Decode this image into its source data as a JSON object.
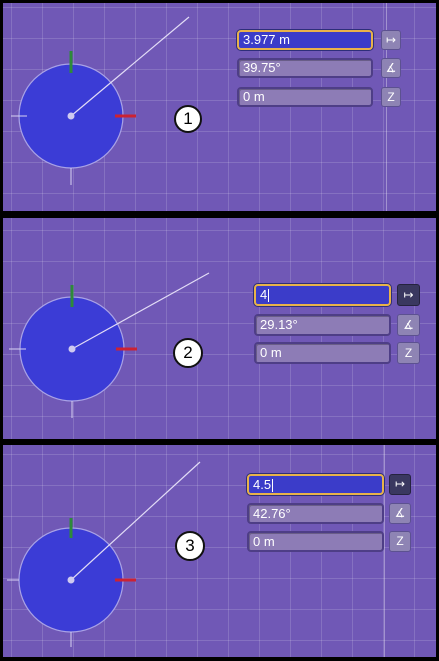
{
  "steps": [
    {
      "number": "1",
      "distance": "3.977 m",
      "angle": "39.75°",
      "z": "0 m"
    },
    {
      "number": "2",
      "distance": "4",
      "angle": "29.13°",
      "z": "0 m"
    },
    {
      "number": "3",
      "distance": "4.5",
      "angle": "42.76°",
      "z": "0 m"
    }
  ],
  "buttons": {
    "distance_glyph": "↦",
    "angle_glyph": "∡",
    "z_glyph": "Z"
  },
  "colors": {
    "background": "#7058b6",
    "circle": "#3b3cd6",
    "active_border": "#e8b24a",
    "y_axis": "#2e8a3a",
    "x_axis": "#cc2233"
  }
}
